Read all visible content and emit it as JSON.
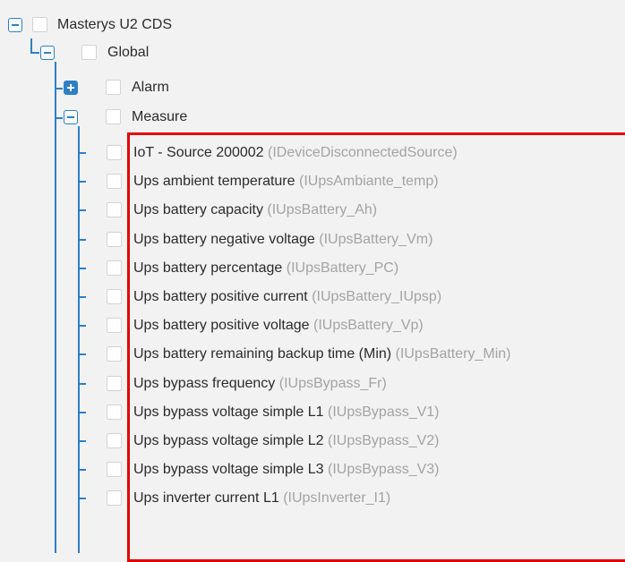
{
  "tree": {
    "root": {
      "label": "Masterys U2 CDS",
      "expanded": true
    },
    "global": {
      "label": "Global",
      "expanded": true
    },
    "alarm": {
      "label": "Alarm",
      "expanded": false
    },
    "measure": {
      "label": "Measure",
      "expanded": true,
      "items": [
        {
          "name": "IoT - Source 200002",
          "code": "(IDeviceDisconnectedSource)"
        },
        {
          "name": "Ups ambient temperature",
          "code": "(IUpsAmbiante_temp)"
        },
        {
          "name": "Ups battery capacity",
          "code": "(IUpsBattery_Ah)"
        },
        {
          "name": "Ups battery negative voltage",
          "code": "(IUpsBattery_Vm)"
        },
        {
          "name": "Ups battery percentage",
          "code": "(IUpsBattery_PC)"
        },
        {
          "name": "Ups battery positive current",
          "code": "(IUpsBattery_IUpsp)"
        },
        {
          "name": "Ups battery positive voltage",
          "code": "(IUpsBattery_Vp)"
        },
        {
          "name": "Ups battery remaining backup time (Min)",
          "code": "(IUpsBattery_Min)"
        },
        {
          "name": "Ups bypass frequency",
          "code": "(IUpsBypass_Fr)"
        },
        {
          "name": "Ups bypass voltage simple L1",
          "code": "(IUpsBypass_V1)"
        },
        {
          "name": "Ups bypass voltage simple L2",
          "code": "(IUpsBypass_V2)"
        },
        {
          "name": "Ups bypass voltage simple L3",
          "code": "(IUpsBypass_V3)"
        },
        {
          "name": "Ups inverter current L1",
          "code": "(IUpsInverter_I1)"
        }
      ]
    }
  },
  "colors": {
    "accent": "#2d7fc6",
    "highlight": "#e30000",
    "muted_text": "#a3a3a3"
  }
}
